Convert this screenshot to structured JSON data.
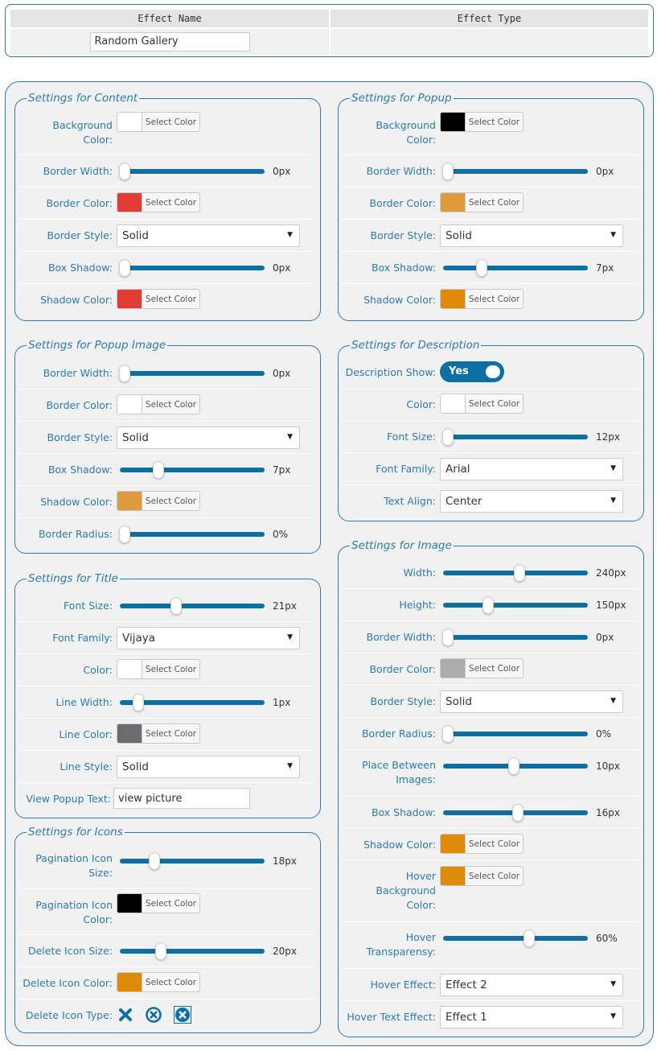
{
  "top": {
    "col1_header": "Effect Name",
    "col2_header": "Effect Type",
    "effect_name": "Random Gallery"
  },
  "common": {
    "select_color": "Select Color"
  },
  "content": {
    "legend": "Settings for Content",
    "bg_label": [
      "Background",
      "Color:"
    ],
    "bg_color": "#ffffff",
    "bw_label": "Border Width:",
    "bw_value": "0px",
    "bw_level": 0,
    "bc_label": "Border Color:",
    "bc_color": "#e33b36",
    "bs_label": "Border Style:",
    "bs_value": "Solid",
    "sh_label": "Box Shadow:",
    "sh_value": "0px",
    "sh_level": 0,
    "shc_label": "Shadow Color:",
    "shc_color": "#e33b36"
  },
  "popup": {
    "legend": "Settings for Popup",
    "bg_label": [
      "Background",
      "Color:"
    ],
    "bg_color": "#000000",
    "bw_label": "Border Width:",
    "bw_value": "0px",
    "bw_level": 0,
    "bc_label": "Border Color:",
    "bc_color": "#de9a3c",
    "bs_label": "Border Style:",
    "bs_value": "Solid",
    "sh_label": "Box Shadow:",
    "sh_value": "7px",
    "sh_level": 0.25,
    "shc_label": "Shadow Color:",
    "shc_color": "#df8a09"
  },
  "popup_image": {
    "legend": "Settings for Popup Image",
    "bw_label": "Border Width:",
    "bw_value": "0px",
    "bw_level": 0,
    "bc_label": "Border Color:",
    "bc_color": "#ffffff",
    "bs_label": "Border Style:",
    "bs_value": "Solid",
    "sh_label": "Box Shadow:",
    "sh_value": "7px",
    "sh_level": 0.25,
    "shc_label": "Shadow Color:",
    "shc_color": "#de9a3c",
    "br_label": "Border Radius:",
    "br_value": "0%",
    "br_level": 0
  },
  "description": {
    "legend": "Settings for Description",
    "show_label": "Description Show:",
    "show_value": "Yes",
    "color_label": "Color:",
    "color": "#ffffff",
    "fs_label": "Font Size:",
    "fs_value": "12px",
    "fs_level": 0,
    "ff_label": "Font Family:",
    "ff_value": "Arial",
    "ta_label": "Text Align:",
    "ta_value": "Center"
  },
  "title": {
    "legend": "Settings for Title",
    "fs_label": "Font Size:",
    "fs_value": "21px",
    "fs_level": 0.38,
    "ff_label": "Font Family:",
    "ff_value": "Vijaya",
    "color_label": "Color:",
    "color": "#ffffff",
    "lw_label": "Line Width:",
    "lw_value": "1px",
    "lw_level": 0.1,
    "lc_label": "Line Color:",
    "lc_color": "#6c6c6e",
    "ls_label": "Line Style:",
    "ls_value": "Solid",
    "vp_label": "View Popup Text:",
    "vp_value": "view picture"
  },
  "image": {
    "legend": "Settings for Image",
    "w_label": "Width:",
    "w_value": "240px",
    "w_level": 0.53,
    "h_label": "Height:",
    "h_value": "150px",
    "h_level": 0.3,
    "bw_label": "Border Width:",
    "bw_value": "0px",
    "bw_level": 0,
    "bc_label": "Border Color:",
    "bc_color": "#acacac",
    "bs_label": "Border Style:",
    "bs_value": "Solid",
    "br_label": "Border Radius:",
    "br_value": "0%",
    "br_level": 0,
    "pb_label": [
      "Place Between",
      "Images:"
    ],
    "pb_value": "10px",
    "pb_level": 0.49,
    "sh_label": "Box Shadow:",
    "sh_value": "16px",
    "sh_level": 0.52,
    "shc_label": "Shadow Color:",
    "shc_color": "#df8a09",
    "hbg_label": [
      "Hover",
      "Background",
      "Color:"
    ],
    "hbg_color": "#df8a09",
    "ht_label": [
      "Hover",
      "Transparensy:"
    ],
    "ht_value": "60%",
    "ht_level": 0.6,
    "he_label": "Hover Effect:",
    "he_value": "Effect 2",
    "hte_label": "Hover Text Effect:",
    "hte_value": "Effect 1"
  },
  "icons": {
    "legend": "Settings for Icons",
    "pis_label": [
      "Pagination Icon",
      "Size:"
    ],
    "pis_value": "18px",
    "pis_level": 0.22,
    "pic_label": [
      "Pagination Icon",
      "Color:"
    ],
    "pic_color": "#000000",
    "dis_label": "Delete Icon Size:",
    "dis_value": "20px",
    "dis_level": 0.27,
    "dic_label": "Delete Icon Color:",
    "dic_color": "#df8a09",
    "dit_label": "Delete Icon Type:",
    "icon_names": [
      "x-cross-icon",
      "x-circle-outline-icon",
      "x-circle-filled-icon"
    ],
    "selected_icon": 2
  }
}
